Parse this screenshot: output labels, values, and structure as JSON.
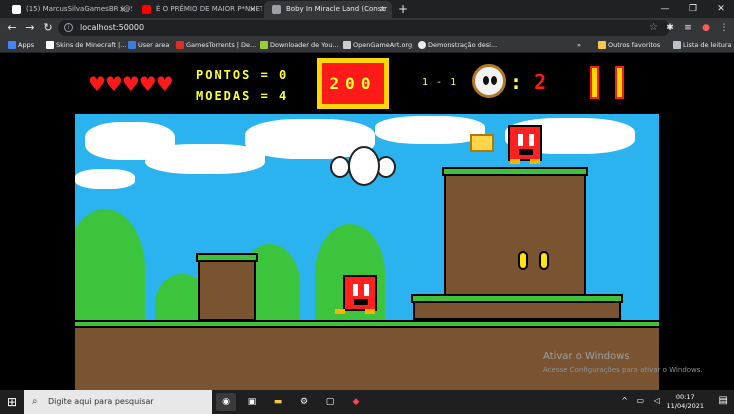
{
  "browser": {
    "tabs": [
      {
        "title": "(15) MarcusSilvaGamesBR (@Silv",
        "icon_color": "#ffffff"
      },
      {
        "title": "É O PRÊMIO DE MAIOR P*NHET",
        "icon_color": "#ff0000"
      },
      {
        "title": "Boby In Miracle Land (Constr",
        "icon_color": "#9aa0a6"
      }
    ],
    "new_tab": "+",
    "url": "localhost:50000",
    "bookmarks": [
      {
        "label": "Apps",
        "color": "#4285f4"
      },
      {
        "label": "Skins de Minecraft |...",
        "color": "#ffffff"
      },
      {
        "label": "User area",
        "color": "#3b7dd8"
      },
      {
        "label": "GamesTorrents | De...",
        "color": "#d93025"
      },
      {
        "label": "Downloader de You...",
        "color": "#9acd32"
      },
      {
        "label": "OpenGameArt.org",
        "color": "#cccccc"
      },
      {
        "label": "Demonstração desi...",
        "color": "#e8eaed"
      }
    ],
    "bookmarks_more": "»",
    "other_favorites": "Outros favoritos",
    "reading_list": "Lista de leitura"
  },
  "game": {
    "hearts": "♥♥♥♥♥",
    "pontos_label": "PONTOS = 0",
    "moedas_label": "MOEDAS = 4",
    "score_value": "200",
    "level": "1 - 1",
    "lives_colon": ":",
    "lives": "2"
  },
  "watermark": {
    "title": "Ativar o Windows",
    "subtitle": "Acesse Configurações para ativar o Windows."
  },
  "taskbar": {
    "search_placeholder": "Digite aqui para pesquisar",
    "time": "00:17",
    "date": "11/04/2021"
  }
}
